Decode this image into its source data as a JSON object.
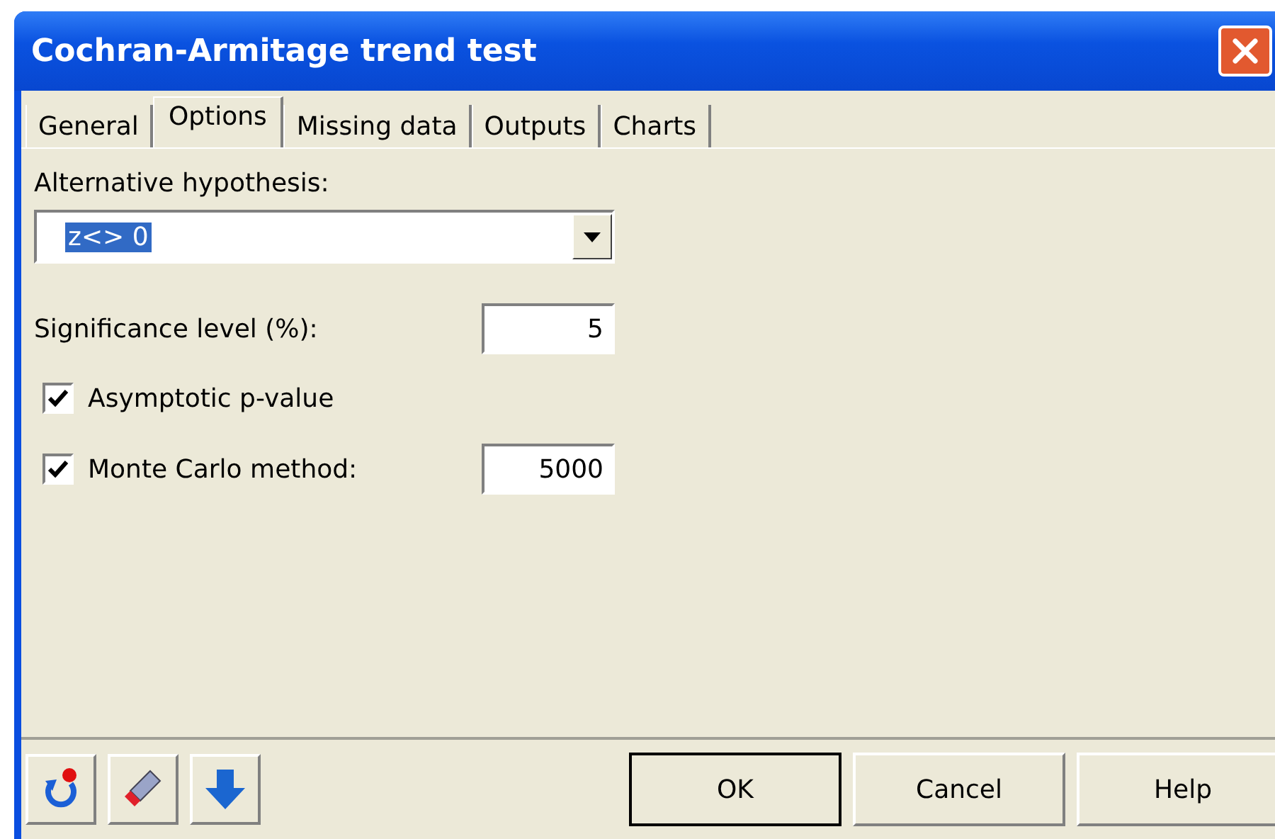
{
  "window": {
    "title": "Cochran-Armitage trend test"
  },
  "tabs": [
    {
      "label": "General",
      "selected": false
    },
    {
      "label": "Options",
      "selected": true
    },
    {
      "label": "Missing data",
      "selected": false
    },
    {
      "label": "Outputs",
      "selected": false
    },
    {
      "label": "Charts",
      "selected": false
    }
  ],
  "alternative_hypothesis": {
    "label": "Alternative hypothesis:",
    "value": "z<> 0",
    "highlighted": true
  },
  "significance_level": {
    "label": "Significance level (%):",
    "value": "5"
  },
  "methods": [
    {
      "label": "Asymptotic p-value",
      "checked": true
    },
    {
      "label": "Monte Carlo method:",
      "checked": true,
      "value": "5000"
    }
  ],
  "buttons": [
    "OK",
    "Cancel",
    "Help"
  ]
}
